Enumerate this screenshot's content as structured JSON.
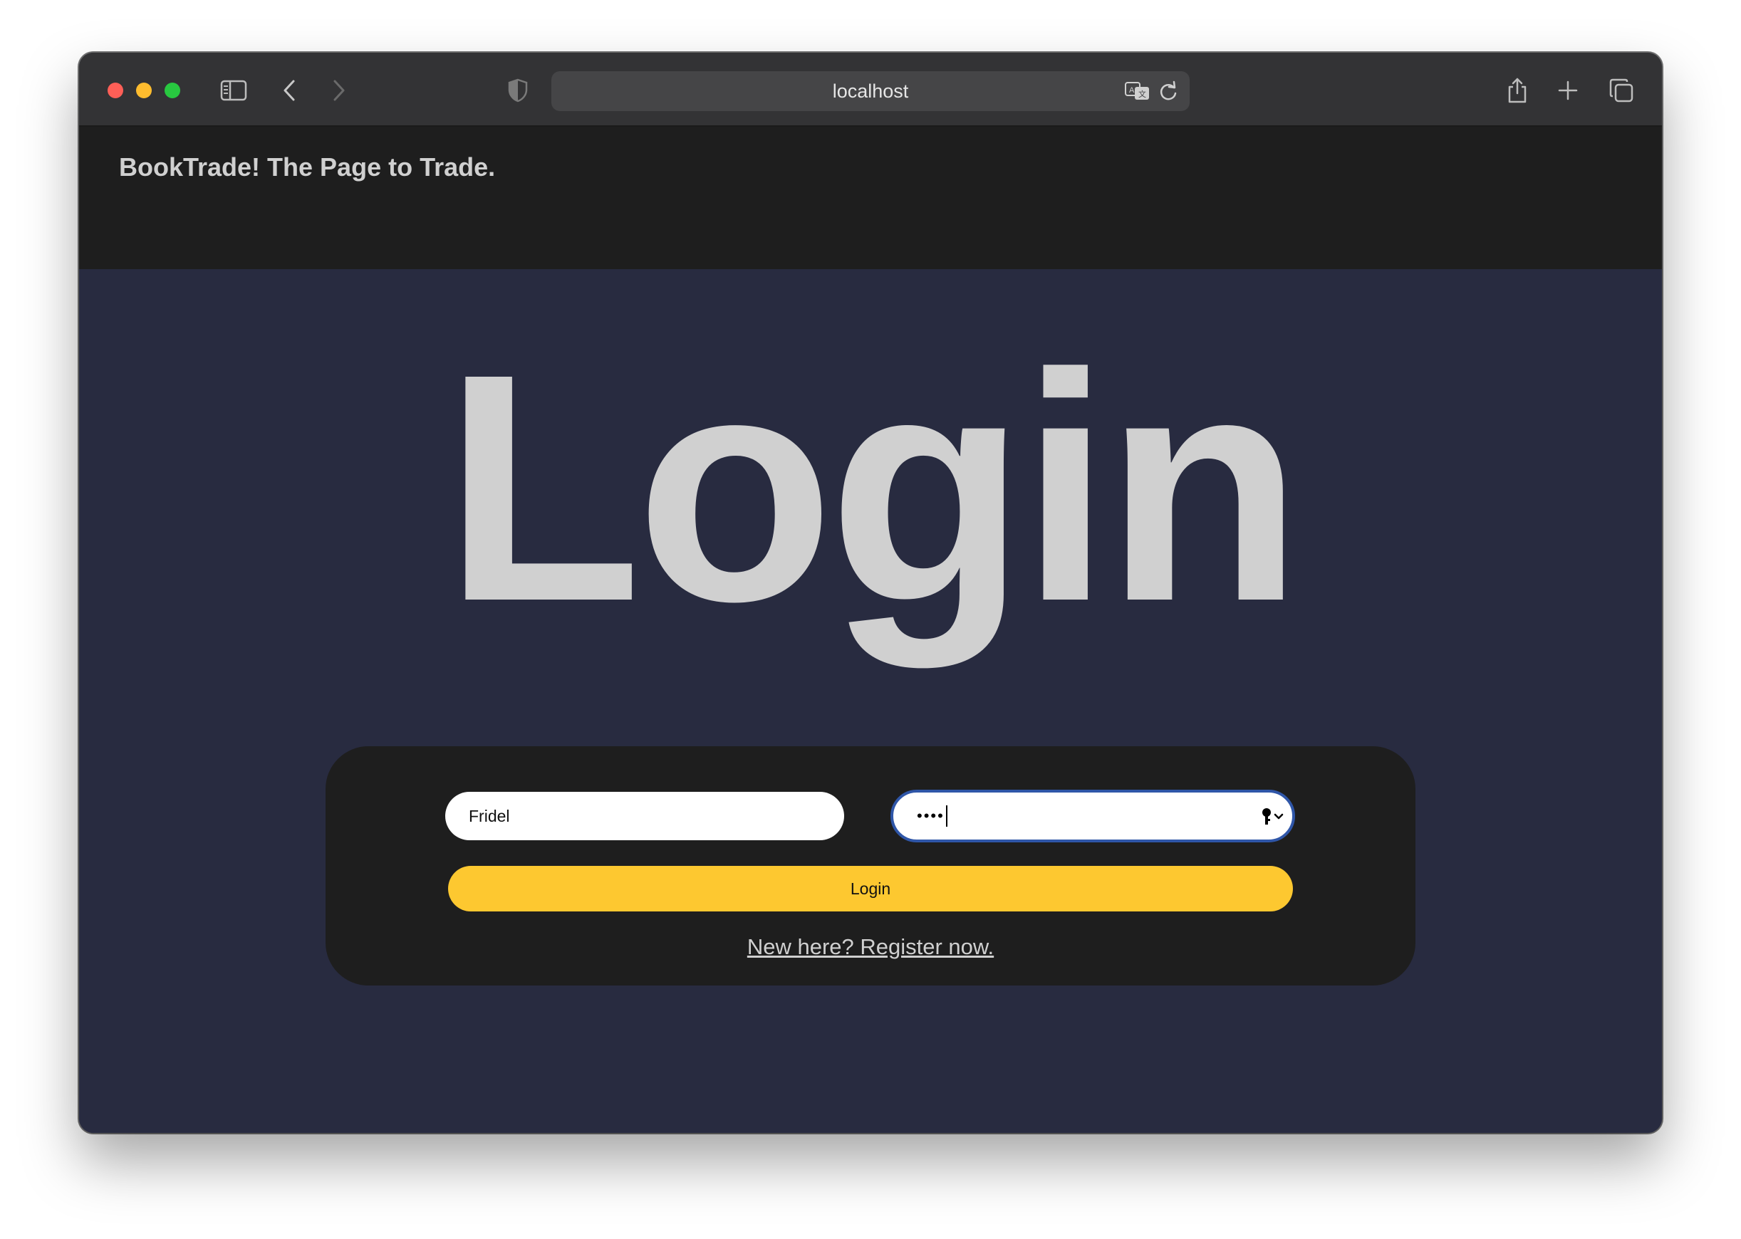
{
  "browser": {
    "url": "localhost",
    "icons": [
      "sidebar-icon",
      "back-icon",
      "forward-icon",
      "shield-icon",
      "translate-icon",
      "reload-icon",
      "share-icon",
      "new-tab-icon",
      "tabs-overview-icon"
    ]
  },
  "header": {
    "brand": "BookTrade! The Page to Trade."
  },
  "main": {
    "title": "Login"
  },
  "login_form": {
    "username_value": "Fridel",
    "password_mask": "••••",
    "submit_label": "Login",
    "register_link": "New here? Register now."
  },
  "colors": {
    "header_bg": "#1e1e1e",
    "page_bg": "#282b40",
    "card_bg": "#1e1e1e",
    "accent": "#fdc830",
    "focus_ring": "#2f56a8",
    "text_light": "#d0d0d0"
  }
}
